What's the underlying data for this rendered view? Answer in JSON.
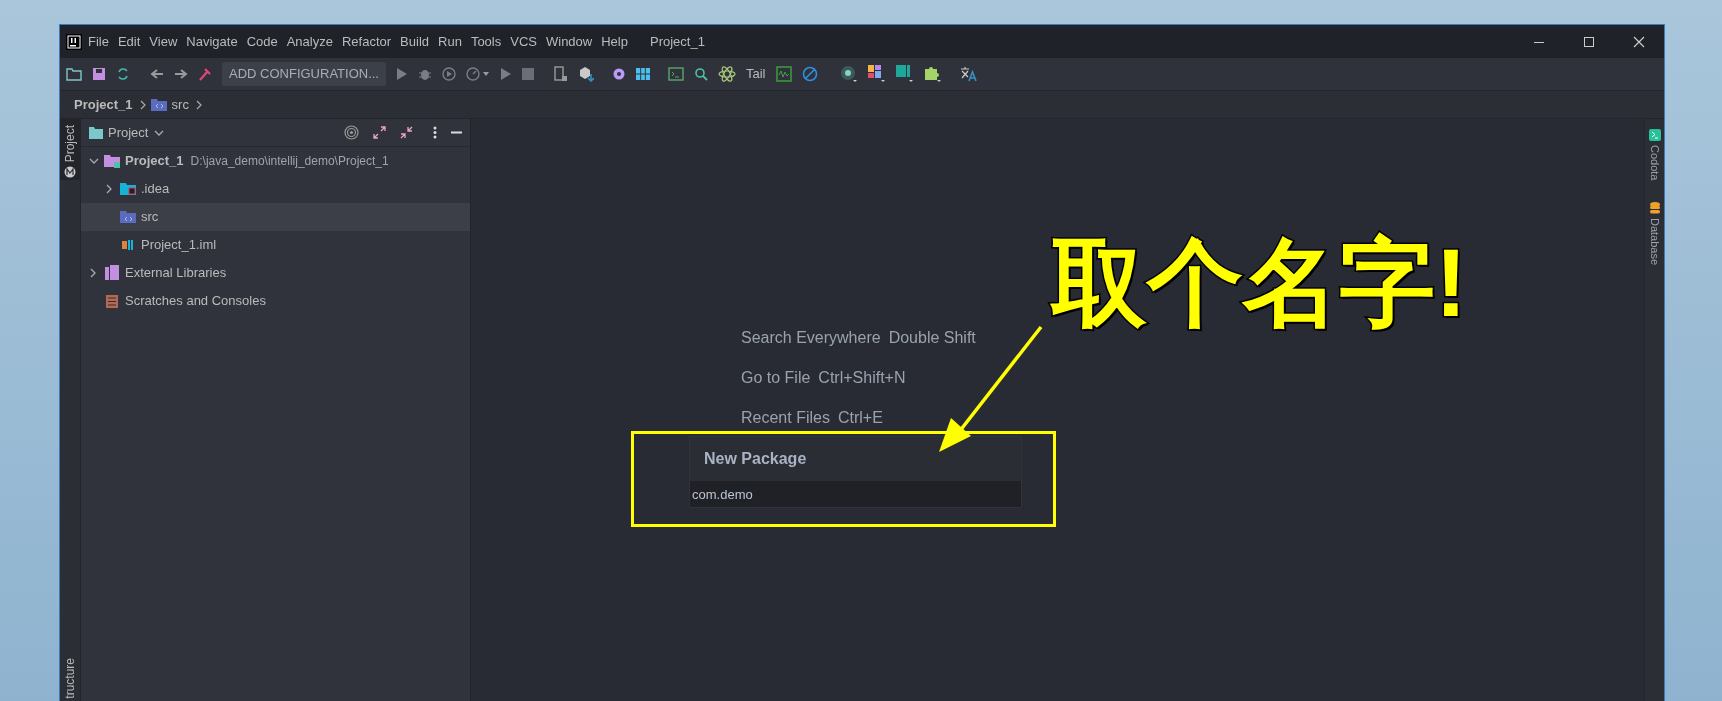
{
  "window": {
    "title": "Project_1"
  },
  "menu": [
    {
      "label": "File"
    },
    {
      "label": "Edit"
    },
    {
      "label": "View"
    },
    {
      "label": "Navigate"
    },
    {
      "label": "Code"
    },
    {
      "label": "Analyze"
    },
    {
      "label": "Refactor"
    },
    {
      "label": "Build"
    },
    {
      "label": "Run"
    },
    {
      "label": "Tools"
    },
    {
      "label": "VCS"
    },
    {
      "label": "Window"
    },
    {
      "label": "Help"
    }
  ],
  "toolbar": {
    "configuration": "ADD CONFIGURATION...",
    "tail": "Tail"
  },
  "breadcrumb": [
    "Project_1",
    "src"
  ],
  "left_strip": [
    {
      "label": "Project",
      "selected": true
    },
    {
      "label": "tructure",
      "selected": false
    }
  ],
  "right_strip": [
    {
      "label": "Codota",
      "kind": "codota"
    },
    {
      "label": "Database",
      "kind": "database"
    }
  ],
  "project_panel": {
    "title": "Project",
    "tree": [
      {
        "kind": "module",
        "label": "Project_1",
        "path": "D:\\java_demo\\intellij_demo\\Project_1",
        "expanded": true,
        "selected": false,
        "children": [
          {
            "kind": "idea",
            "label": ".idea",
            "expanded": false,
            "selected": false
          },
          {
            "kind": "source",
            "label": "src",
            "selected": true
          },
          {
            "kind": "iml",
            "label": "Project_1.iml",
            "selected": false
          }
        ]
      },
      {
        "kind": "library",
        "label": "External Libraries",
        "expanded": false,
        "selected": false
      },
      {
        "kind": "scratches",
        "label": "Scratches and Consoles",
        "selected": false
      }
    ]
  },
  "hints": [
    {
      "label": "Search Everywhere",
      "shortcut": "Double Shift"
    },
    {
      "label": "Go to File",
      "shortcut": "Ctrl+Shift+N"
    },
    {
      "label": "Recent Files",
      "shortcut": "Ctrl+E"
    }
  ],
  "dialog": {
    "title": "New Package",
    "value": "com.demo"
  },
  "annotation": {
    "text": "取个名字!"
  }
}
